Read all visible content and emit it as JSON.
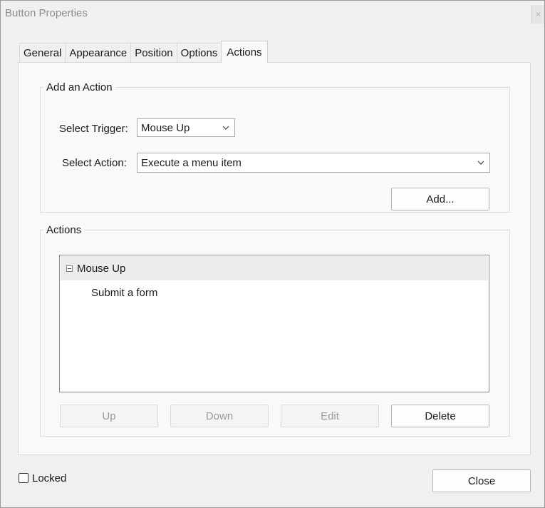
{
  "window": {
    "title": "Button Properties",
    "close_glyph": "×"
  },
  "tabs": [
    {
      "label": "General",
      "active": false
    },
    {
      "label": "Appearance",
      "active": false
    },
    {
      "label": "Position",
      "active": false
    },
    {
      "label": "Options",
      "active": false
    },
    {
      "label": "Actions",
      "active": true
    }
  ],
  "add_action": {
    "legend": "Add an Action",
    "trigger_label": "Select Trigger:",
    "trigger_value": "Mouse Up",
    "action_label": "Select Action:",
    "action_value": "Execute a menu item",
    "add_button": "Add..."
  },
  "actions": {
    "legend": "Actions",
    "tree": [
      {
        "trigger": "Mouse Up",
        "expanded": true,
        "children": [
          "Submit a form"
        ]
      }
    ],
    "buttons": {
      "up": "Up",
      "down": "Down",
      "edit": "Edit",
      "delete": "Delete"
    }
  },
  "locked": {
    "label": "Locked",
    "checked": false
  },
  "close_button": "Close",
  "icons": {
    "dropdown": "chevron-down-icon",
    "tree_toggle": "collapse-minus-icon",
    "window_close": "close-icon"
  }
}
